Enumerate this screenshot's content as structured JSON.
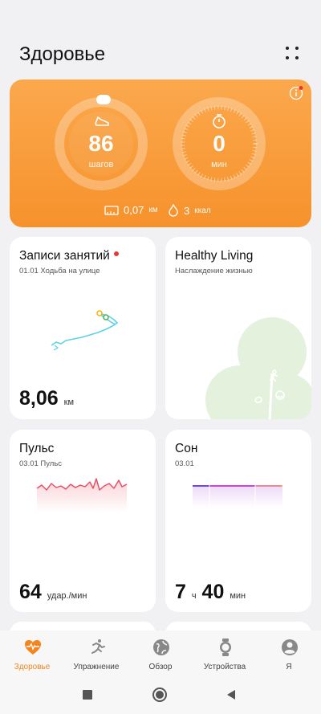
{
  "header": {
    "title": "Здоровье"
  },
  "hero": {
    "steps_value": "86",
    "steps_label": "шагов",
    "minutes_value": "0",
    "minutes_label": "мин",
    "distance_value": "0,07",
    "distance_unit": "км",
    "calories_value": "3",
    "calories_unit": "ккал",
    "steps_progress": 0.02,
    "minutes_progress": 0
  },
  "cards": {
    "activity": {
      "title": "Записи занятий",
      "subtitle": "01.01  Ходьба на улице",
      "value": "8,06",
      "unit": "км"
    },
    "healthy": {
      "title": "Healthy Living",
      "subtitle": "Наслаждение жизнью"
    },
    "pulse": {
      "title": "Пульс",
      "subtitle": "03.01  Пульс",
      "value": "64",
      "unit": "удар./мин"
    },
    "sleep": {
      "title": "Сон",
      "subtitle": "03.01",
      "hours": "7",
      "hours_unit": "ч",
      "minutes": "40",
      "minutes_unit": "мин"
    }
  },
  "tabs": [
    {
      "label": "Здоровье",
      "icon": "heart-pulse-icon",
      "active": true
    },
    {
      "label": "Упражнение",
      "icon": "running-icon",
      "active": false
    },
    {
      "label": "Обзор",
      "icon": "globe-icon",
      "active": false
    },
    {
      "label": "Устройства",
      "icon": "watch-icon",
      "active": false
    },
    {
      "label": "Я",
      "icon": "person-icon",
      "active": false
    }
  ],
  "colors": {
    "accent": "#f4851e",
    "hero_orange": "#f7982f",
    "pulse_red": "#e84a5f",
    "sleep_purple": "#a23ad6"
  }
}
